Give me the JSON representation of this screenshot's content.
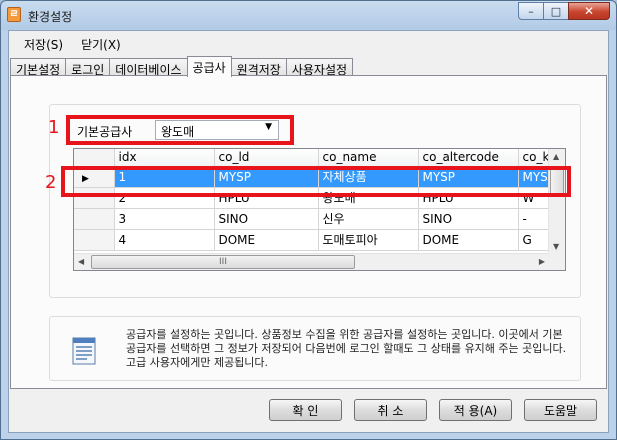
{
  "window": {
    "title": "환경설정",
    "controls": {
      "minimize": "–",
      "maximize": "□",
      "close": "✕"
    }
  },
  "menu": [
    "저장(S)",
    "닫기(X)"
  ],
  "tabs": [
    "기본설정",
    "로그인",
    "데이터베이스",
    "공급사",
    "원격저장",
    "사용자설정"
  ],
  "active_tab": "공급사",
  "supplier": {
    "label": "기본공급사",
    "value": "왕도매"
  },
  "grid": {
    "columns": [
      "idx",
      "co_ld",
      "co_name",
      "co_altercode",
      "co_ko"
    ],
    "rows": [
      [
        "1",
        "MYSP",
        "자체상품",
        "MYSP",
        "MYSP"
      ],
      [
        "2",
        "HPLU",
        "왕도매",
        "HPLU",
        "W"
      ],
      [
        "3",
        "SINO",
        "신우",
        "SINO",
        "-"
      ],
      [
        "4",
        "DOME",
        "도매토피아",
        "DOME",
        "G"
      ]
    ],
    "selected_row": 0,
    "hscroll_grip": "III"
  },
  "annotations": {
    "box1_number": "1",
    "box2_number": "2",
    "color": "#e8141c"
  },
  "info": {
    "text": "공급자를 설정하는 곳입니다. 상품정보 수집을 위한 공급자를 설정하는 곳입니다. 이곳에서 기본 공급자를 선택하면 그 정보가 저장되어 다음번에 로그인 할때도 그 상태를 유지해 주는 곳입니다. 고급 사용자에게만 제공됩니다."
  },
  "buttons": {
    "ok": "확 인",
    "cancel": "취 소",
    "apply": "적 용(A)",
    "help": "도움말"
  }
}
